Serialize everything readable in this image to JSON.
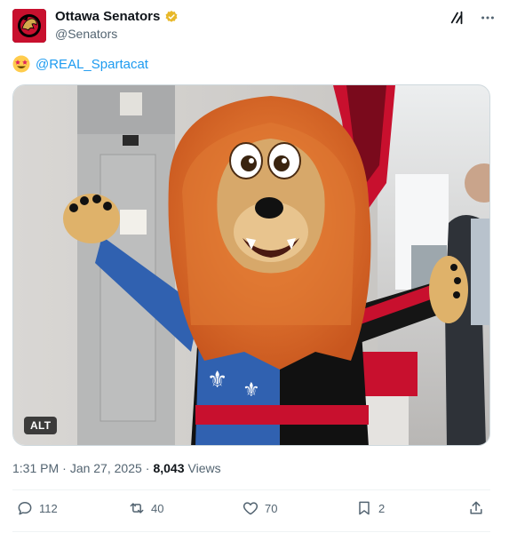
{
  "author": {
    "name": "Ottawa Senators",
    "handle": "@Senators"
  },
  "tweet": {
    "emoji": "star-struck",
    "mention": "@REAL_Spartacat"
  },
  "media": {
    "alt_label": "ALT"
  },
  "meta": {
    "time": "1:31 PM",
    "date": "Jan 27, 2025",
    "views_count": "8,043",
    "views_label": "Views"
  },
  "actions": {
    "replies": "112",
    "reposts": "40",
    "likes": "70",
    "bookmarks": "2"
  },
  "colors": {
    "accent": "#1d9bf0",
    "muted": "#536471",
    "verified_gold": "#e8b829",
    "senators_red": "#c8102e"
  }
}
